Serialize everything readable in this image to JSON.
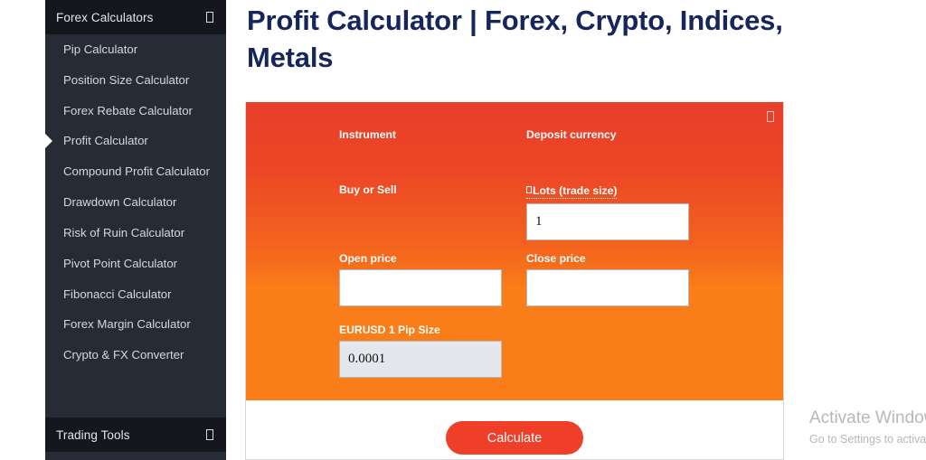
{
  "sidebar": {
    "sections": [
      {
        "label": "Forex Calculators",
        "icon": "chevron-toggle-icon"
      },
      {
        "label": "Trading Tools",
        "icon": "chevron-toggle-icon"
      }
    ],
    "items": [
      {
        "label": "Pip Calculator",
        "active": false
      },
      {
        "label": "Position Size Calculator",
        "active": false
      },
      {
        "label": "Forex Rebate Calculator",
        "active": false
      },
      {
        "label": "Profit Calculator",
        "active": true
      },
      {
        "label": "Compound Profit Calculator",
        "active": false
      },
      {
        "label": "Drawdown Calculator",
        "active": false
      },
      {
        "label": "Risk of Ruin Calculator",
        "active": false
      },
      {
        "label": "Pivot Point Calculator",
        "active": false
      },
      {
        "label": "Fibonacci Calculator",
        "active": false
      },
      {
        "label": "Forex Margin Calculator",
        "active": false
      },
      {
        "label": "Crypto & FX Converter",
        "active": false
      }
    ]
  },
  "main": {
    "title": "Profit Calculator | Forex, Crypto, Indices, Metals"
  },
  "calculator": {
    "corner_icon": "info-icon",
    "fields": {
      "instrument": {
        "label": "Instrument"
      },
      "deposit_currency": {
        "label": "Deposit currency"
      },
      "buy_or_sell": {
        "label": "Buy or Sell"
      },
      "lots": {
        "label": "Lots (trade size)",
        "value": "1"
      },
      "open_price": {
        "label": "Open price",
        "value": ""
      },
      "close_price": {
        "label": "Close price",
        "value": ""
      },
      "pip_size": {
        "label": "EURUSD 1 Pip Size",
        "value": "0.0001"
      }
    },
    "calculate_label": "Calculate"
  },
  "watermark": {
    "title": "Activate Windows",
    "subtitle": "Go to Settings to activate Windows."
  }
}
